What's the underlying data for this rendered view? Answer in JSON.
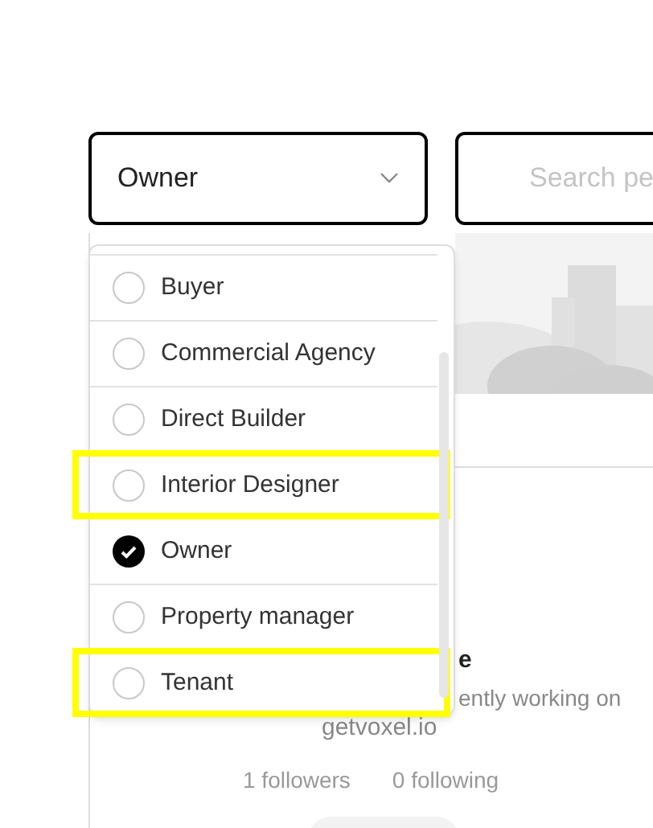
{
  "role_select": {
    "value": "Owner"
  },
  "search": {
    "placeholder": "Search pe"
  },
  "role_options": [
    {
      "label": "Buyer",
      "checked": false,
      "highlighted": false
    },
    {
      "label": "Commercial Agency",
      "checked": false,
      "highlighted": false
    },
    {
      "label": "Direct Builder",
      "checked": false,
      "highlighted": false
    },
    {
      "label": "Interior Designer",
      "checked": false,
      "highlighted": true
    },
    {
      "label": "Owner",
      "checked": true,
      "highlighted": false
    },
    {
      "label": "Property manager",
      "checked": false,
      "highlighted": false
    },
    {
      "label": "Tenant",
      "checked": false,
      "highlighted": true
    }
  ],
  "profile_card": {
    "name": "e",
    "bio_line": "ently working on",
    "link": "getvoxel.io",
    "followers": "1 followers",
    "following": "0 following"
  }
}
